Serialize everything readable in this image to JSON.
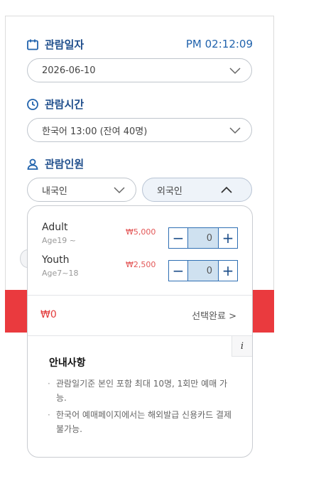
{
  "date_section": {
    "title": "관람일자",
    "clock": "PM 02:12:09",
    "selected": "2026-06-10"
  },
  "time_section": {
    "title": "관람시간",
    "selected": "한국어 13:00 (잔여 40명)"
  },
  "people_section": {
    "title": "관람인원",
    "tab_domestic": "내국인",
    "tab_foreign": "외국인"
  },
  "tickets": [
    {
      "name": "Adult",
      "age": "Age19 ~",
      "price": "₩5,000",
      "qty": "0"
    },
    {
      "name": "Youth",
      "age": "Age7~18",
      "price": "₩2,500",
      "qty": "0"
    }
  ],
  "stepper": {
    "minus": "−",
    "plus": "+"
  },
  "summary": {
    "total": "₩0",
    "done_label": "선택완료 >"
  },
  "notice": {
    "info_icon_label": "i",
    "title": "안내사항",
    "items": [
      "관람일기준 본인 포함 최대 10명, 1회만 예매 가능.",
      "한국어 예매페이지에서는 해외발급 신용카드 결제 불가능."
    ],
    "bullet": "·"
  },
  "colors": {
    "accent": "#2163ad",
    "red": "#ea3a3e",
    "stepper_fill": "#cfe1f0"
  }
}
